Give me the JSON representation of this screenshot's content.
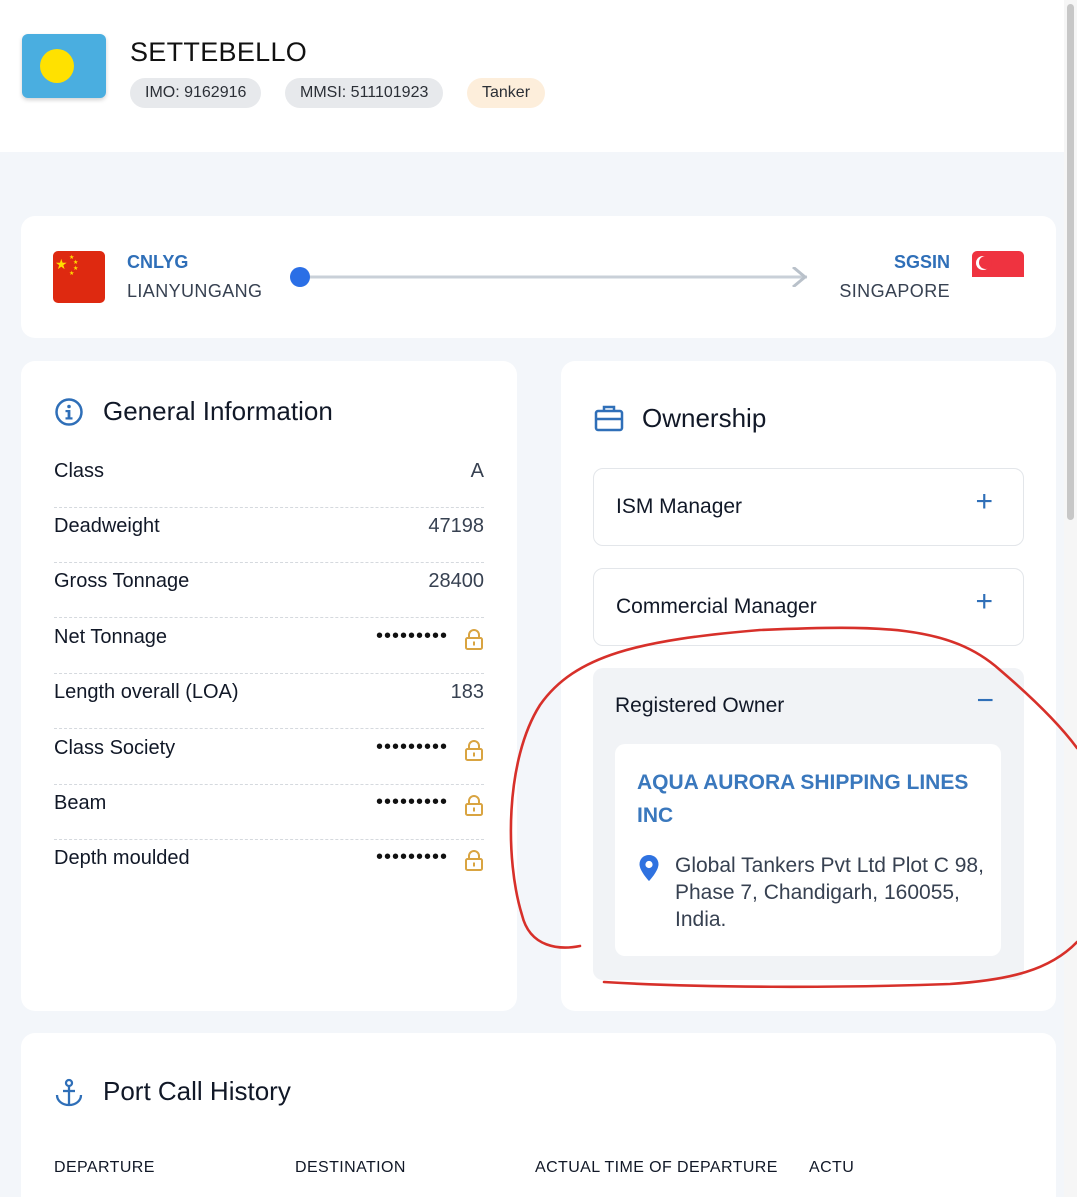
{
  "vessel": {
    "name": "SETTEBELLO",
    "imo": "IMO: 9162916",
    "mmsi": "MMSI: 511101923",
    "type": "Tanker",
    "flag_icon": "palau-flag-icon"
  },
  "route": {
    "origin": {
      "code": "CNLYG",
      "name": "LIANYUNGANG",
      "flag_icon": "china-flag-icon"
    },
    "destination": {
      "code": "SGSIN",
      "name": "SINGAPORE",
      "flag_icon": "singapore-flag-icon"
    }
  },
  "general": {
    "title": "General Information",
    "rows": [
      {
        "label": "Class",
        "value": "A"
      },
      {
        "label": "Deadweight",
        "value": "47198"
      },
      {
        "label": "Gross Tonnage",
        "value": "28400"
      },
      {
        "label": "Net Tonnage",
        "value": "•••••••••"
      },
      {
        "label": "Length overall (LOA)",
        "value": "183"
      },
      {
        "label": "Class Society",
        "value": "•••••••••"
      },
      {
        "label": "Beam",
        "value": "•••••••••"
      },
      {
        "label": "Depth moulded",
        "value": "•••••••••"
      }
    ]
  },
  "ownership": {
    "title": "Ownership",
    "ism_manager": "ISM Manager",
    "commercial_manager": "Commercial Manager",
    "registered_owner": "Registered Owner",
    "expand_symbol": "+",
    "collapse_symbol": "−",
    "owner_name": "AQUA AURORA SHIPPING LINES INC",
    "owner_address": "Global Tankers Pvt Ltd Plot C 98, Phase 7, Chandigarh, 160055, India."
  },
  "port_calls": {
    "title": "Port Call History",
    "columns": [
      "DEPARTURE",
      "DESTINATION",
      "ACTUAL TIME OF DEPARTURE",
      "ACTU"
    ]
  },
  "colors": {
    "accent": "#2f6fb8",
    "annotation": "#d7302a",
    "lock": "#d9a441"
  }
}
